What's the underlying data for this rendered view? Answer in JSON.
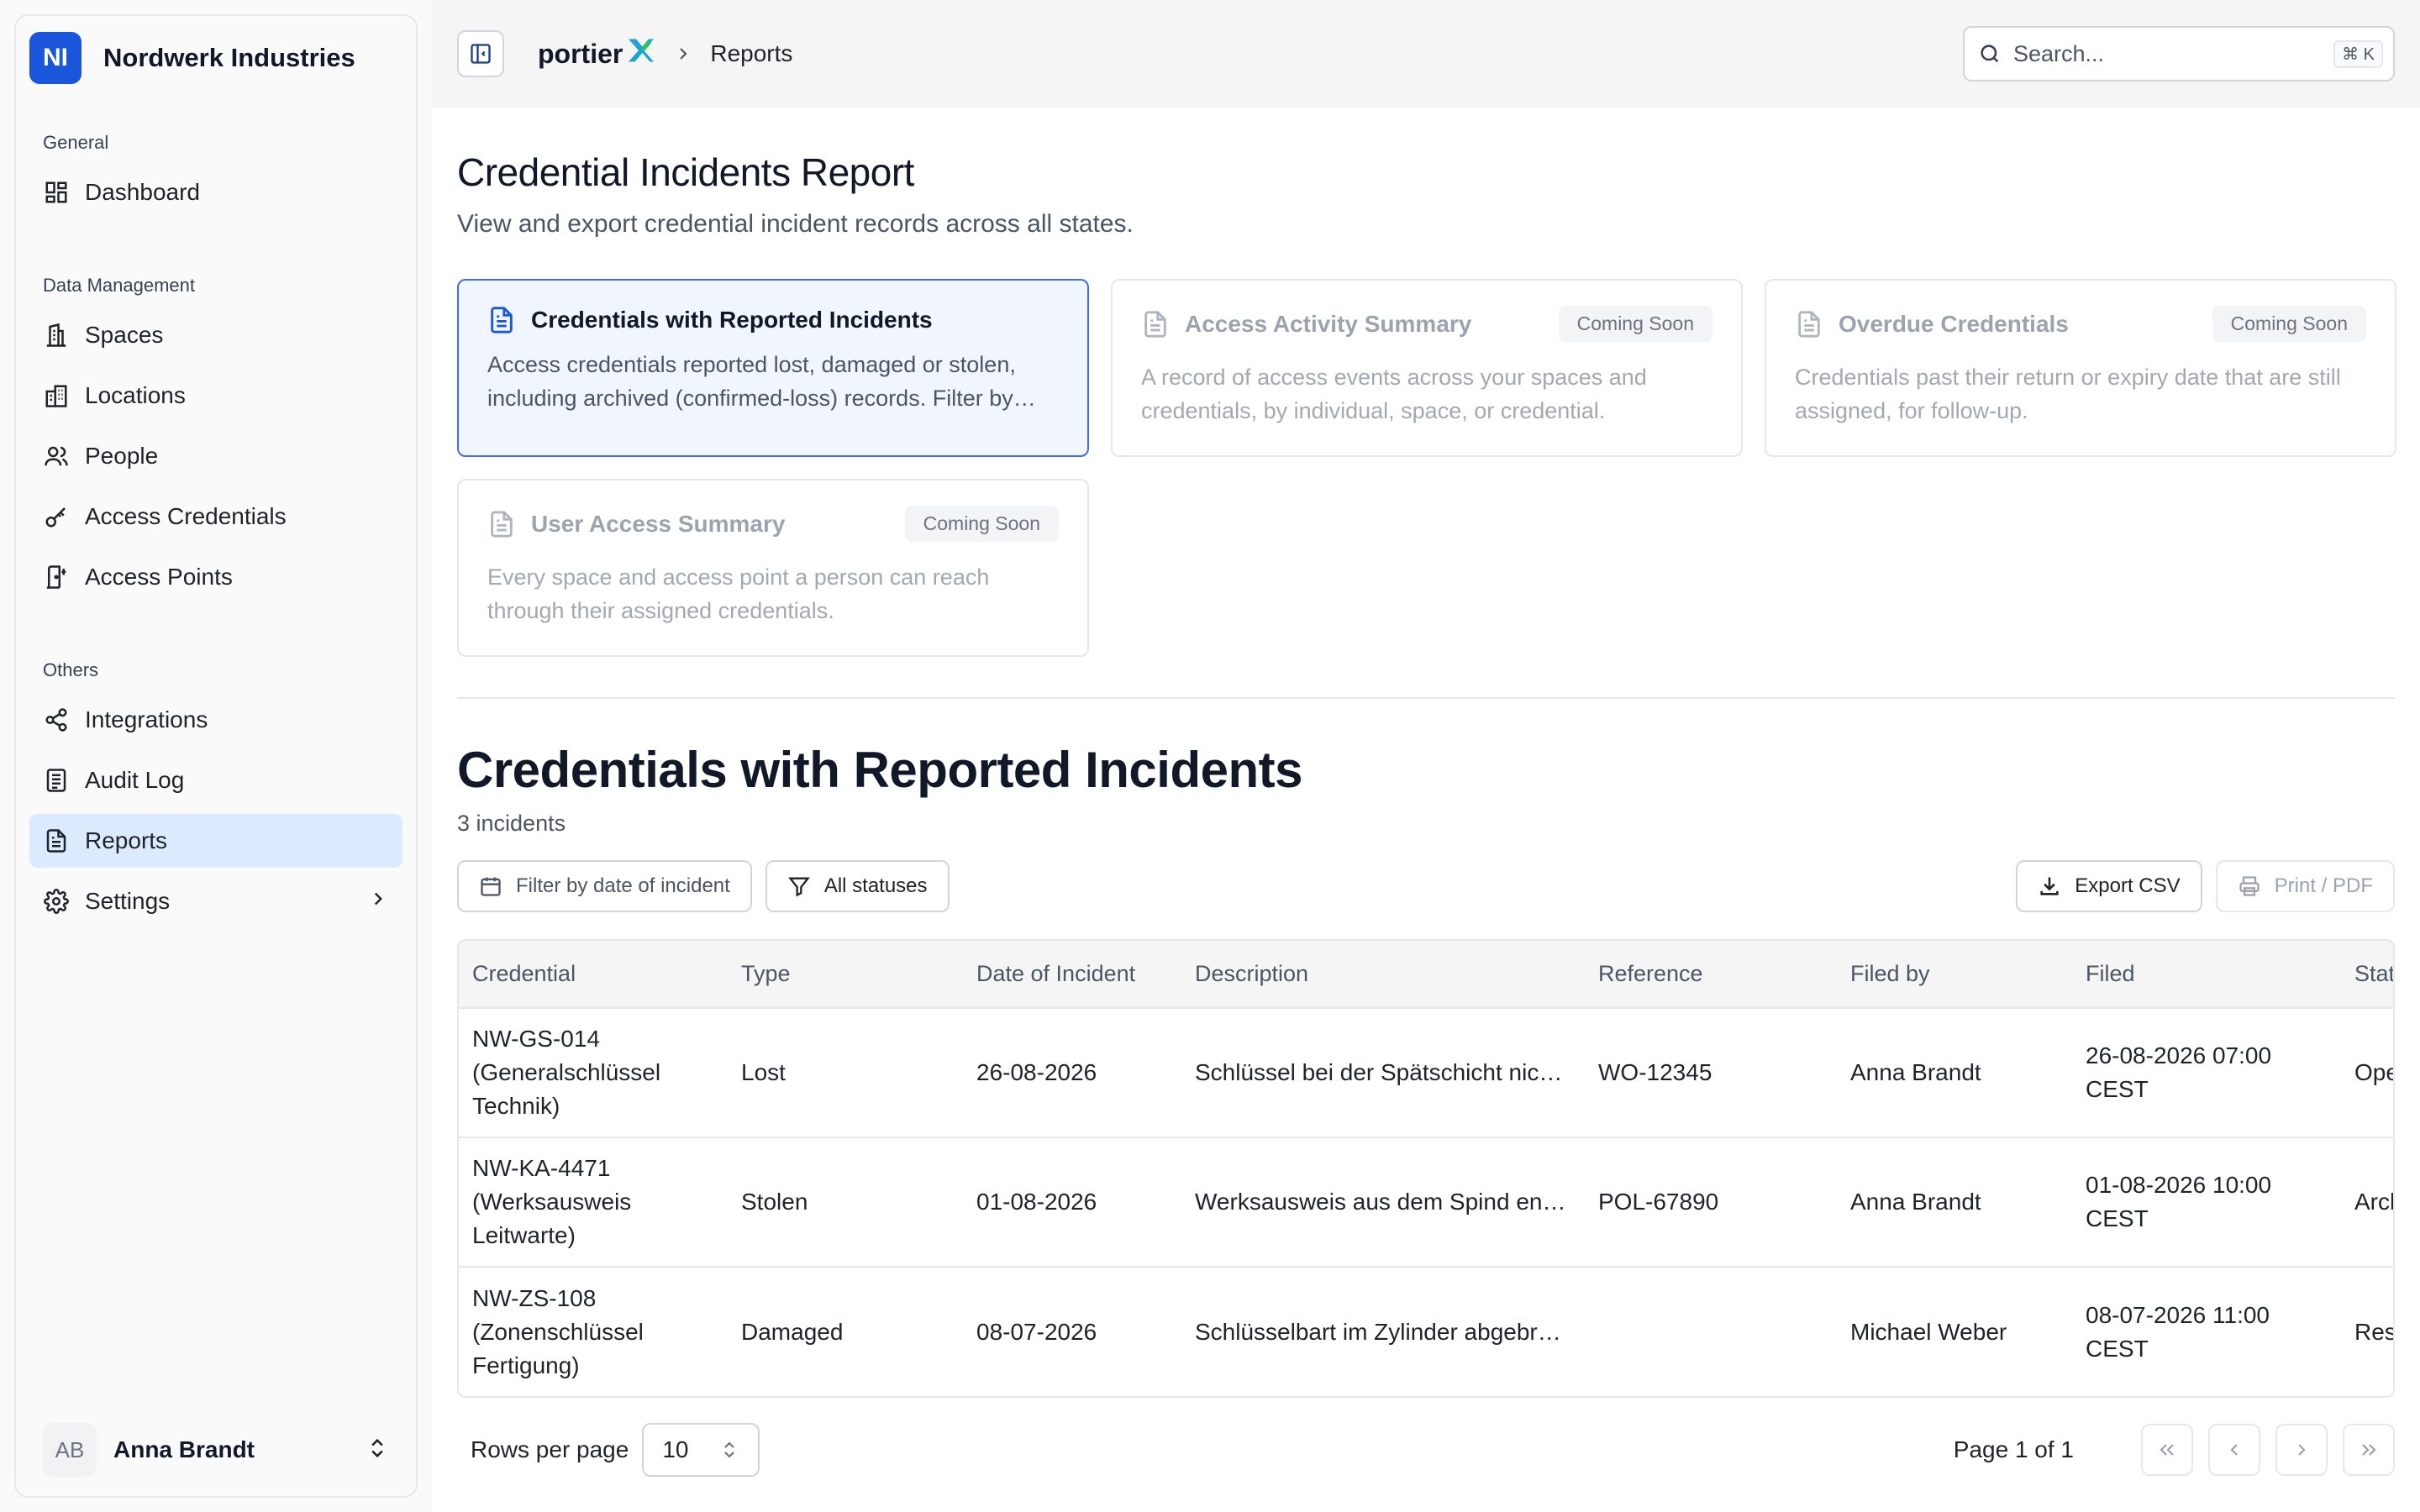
{
  "sidebar": {
    "org": {
      "initials": "NI",
      "name": "Nordwerk Industries"
    },
    "groups": [
      {
        "label": "General",
        "items": [
          {
            "label": "Dashboard",
            "icon": "dashboard-icon"
          }
        ]
      },
      {
        "label": "Data Management",
        "items": [
          {
            "label": "Spaces",
            "icon": "building-icon"
          },
          {
            "label": "Locations",
            "icon": "buildings-icon"
          },
          {
            "label": "People",
            "icon": "people-icon"
          },
          {
            "label": "Access Credentials",
            "icon": "key-icon"
          },
          {
            "label": "Access Points",
            "icon": "door-icon"
          }
        ]
      },
      {
        "label": "Others",
        "items": [
          {
            "label": "Integrations",
            "icon": "share-icon"
          },
          {
            "label": "Audit Log",
            "icon": "log-icon"
          },
          {
            "label": "Reports",
            "icon": "report-icon",
            "active": true
          },
          {
            "label": "Settings",
            "icon": "gear-icon"
          }
        ]
      }
    ],
    "user": {
      "initials": "AB",
      "name": "Anna Brandt"
    }
  },
  "topbar": {
    "brand": "portier",
    "breadcrumb": "Reports",
    "search": {
      "placeholder": "Search...",
      "shortcut": "⌘ K"
    }
  },
  "page": {
    "title": "Credential Incidents Report",
    "subtitle": "View and export credential incident records across all states."
  },
  "cards": [
    {
      "title": "Credentials with Reported Incidents",
      "desc": "Access credentials reported lost, damaged or stolen, including archived (confirmed-loss) records. Filter by…",
      "active": true
    },
    {
      "title": "Access Activity Summary",
      "badge": "Coming Soon",
      "desc": "A record of access events across your spaces and credentials, by individual, space, or credential."
    },
    {
      "title": "Overdue Credentials",
      "badge": "Coming Soon",
      "desc": "Credentials past their return or expiry date that are still assigned, for follow-up."
    },
    {
      "title": "User Access Summary",
      "badge": "Coming Soon",
      "desc": "Every space and access point a person can reach through their assigned credentials."
    }
  ],
  "section": {
    "title": "Credentials with Reported Incidents",
    "count": "3 incidents",
    "filter_date": "Filter by date of incident",
    "filter_status": "All statuses",
    "export": "Export CSV",
    "print": "Print / PDF"
  },
  "table": {
    "columns": [
      "Credential",
      "Type",
      "Date of Incident",
      "Description",
      "Reference",
      "Filed by",
      "Filed",
      "Status"
    ],
    "rows": [
      [
        "NW-GS-014 (Generalschlüssel Technik)",
        "Lost",
        "26-08-2026",
        "Schlüssel bei der Spätschicht nicht mehr auffindbar",
        "WO-12345",
        "Anna Brandt",
        "26-08-2026 07:00 CEST",
        "Open"
      ],
      [
        "NW-KA-4471 (Werksausweis Leitwarte)",
        "Stolen",
        "01-08-2026",
        "Werksausweis aus dem Spind entwendet",
        "POL-67890",
        "Anna Brandt",
        "01-08-2026 10:00 CEST",
        "Archived"
      ],
      [
        "NW-ZS-108 (Zonenschlüssel Fertigung)",
        "Damaged",
        "08-07-2026",
        "Schlüsselbart im Zylinder abgebrochen",
        "",
        "Michael Weber",
        "08-07-2026 11:00 CEST",
        "Resolved"
      ]
    ]
  },
  "pager": {
    "rows_label": "Rows per page",
    "rows_value": "10",
    "page_info": "Page 1 of 1"
  },
  "colors": {
    "accent": "#1a56db",
    "active_nav": "#dbeafe",
    "active_card_border": "#3b6ee8"
  }
}
